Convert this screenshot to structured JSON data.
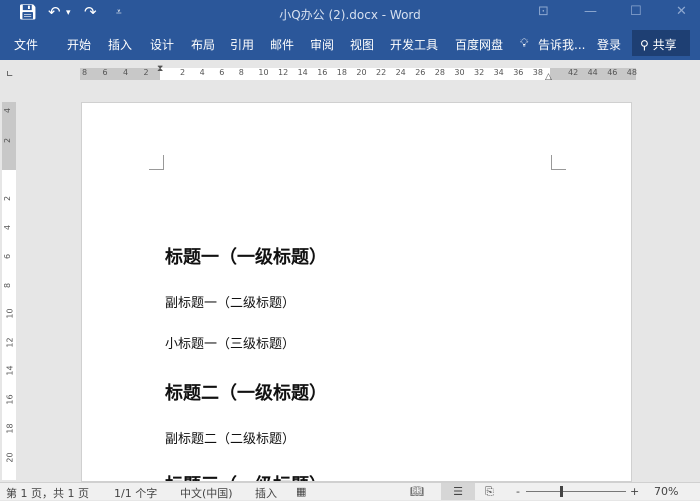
{
  "title": "小Q办公 (2).docx - Word",
  "ribbon": {
    "tabs": [
      "文件",
      "开始",
      "插入",
      "设计",
      "布局",
      "引用",
      "邮件",
      "审阅",
      "视图",
      "开发工具",
      "百度网盘"
    ],
    "tell_me": "告诉我...",
    "login": "登录",
    "share": "共享"
  },
  "ruler": {
    "left": [
      "8",
      "6",
      "4",
      "2"
    ],
    "main": [
      "2",
      "4",
      "6",
      "8",
      "10",
      "12",
      "14",
      "16",
      "18",
      "20",
      "22",
      "24",
      "26",
      "28",
      "30",
      "32",
      "34",
      "36",
      "38"
    ],
    "right": [
      "42",
      "44",
      "46",
      "48"
    ],
    "vertical": [
      "4",
      "2",
      "2",
      "4",
      "6",
      "8",
      "10",
      "12",
      "14",
      "16",
      "18",
      "20"
    ]
  },
  "doc": {
    "headings": [
      {
        "text": "标题一（一级标题）",
        "level": 1
      },
      {
        "text": "副标题一（二级标题）",
        "level": 2
      },
      {
        "text": "小标题一（三级标题）",
        "level": 3
      },
      {
        "text": "标题二（一级标题）",
        "level": 1
      },
      {
        "text": "副标题二（二级标题）",
        "level": 2
      },
      {
        "text": "标题三（一级标题）",
        "level": 1
      }
    ]
  },
  "status": {
    "page": "第 1 页，共 1 页",
    "words": "1/1 个字",
    "lang": "中文(中国)",
    "mode": "插入",
    "zoom": "70%",
    "zoom_value": 70
  }
}
